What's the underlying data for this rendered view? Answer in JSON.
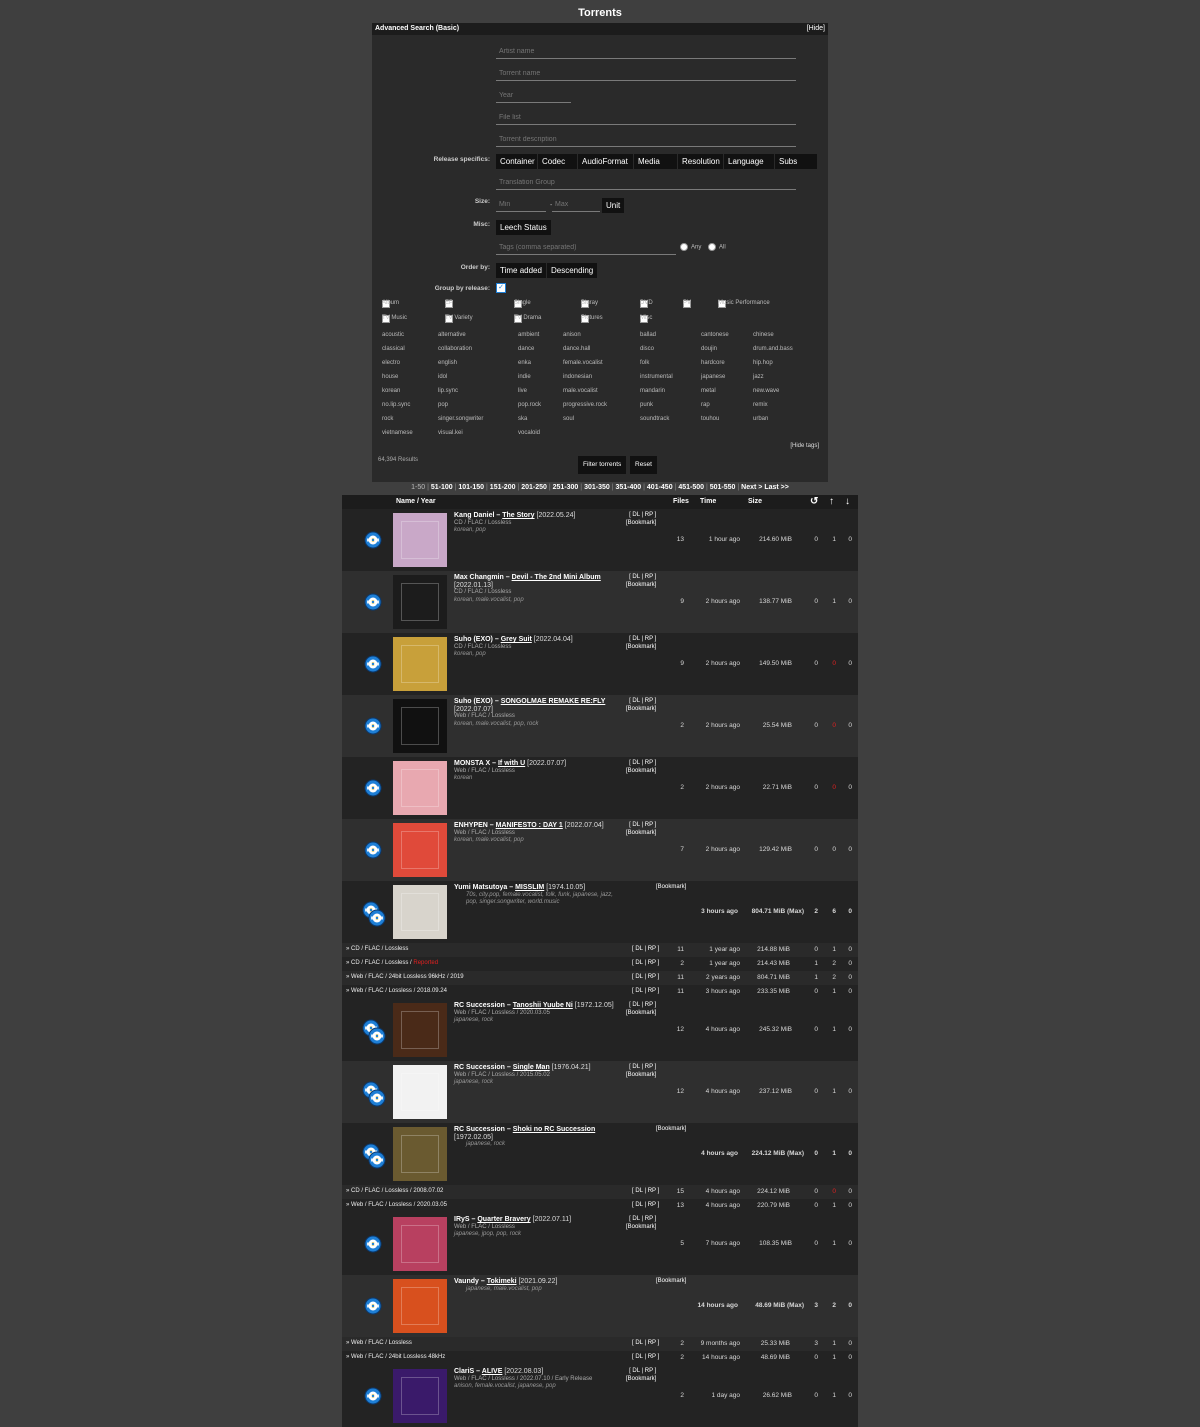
{
  "page_title": "Torrents",
  "search": {
    "title": "Advanced Search",
    "mode_link": "Basic",
    "hide_label": "[Hide]",
    "placeholders": {
      "artist": "Artist name",
      "torrent": "Torrent name",
      "year": "Year",
      "filelist": "File list",
      "description": "Torrent description",
      "translation": "Translation Group",
      "size_min": "Min",
      "size_max": "Max",
      "tags": "Tags (comma separated)"
    },
    "labels": {
      "release_specifics": "Release specifics:",
      "size": "Size:",
      "misc": "Misc:",
      "order_by": "Order by:",
      "group_by": "Group by release:"
    },
    "specifics": [
      "Container",
      "Codec",
      "AudioFormat",
      "Media",
      "Resolution",
      "Language",
      "Subs"
    ],
    "size_unit": "Unit",
    "size_sep": "-",
    "misc_select": "Leech Status",
    "tag_any": "Any",
    "tag_all": "All",
    "order_field": "Time added",
    "order_dir": "Descending",
    "categories_row1": [
      "Album",
      "EP",
      "Single",
      "Bluray",
      "DVD",
      "PV",
      "Music Performance"
    ],
    "categories_row2": [
      "TV Music",
      "TV Variety",
      "TV Drama",
      "Pictures",
      "Misc"
    ],
    "tags": [
      [
        "acoustic",
        "alternative",
        "ambient",
        "anison",
        "ballad",
        "cantonese",
        "chinese"
      ],
      [
        "classical",
        "collaboration",
        "dance",
        "dance.hall",
        "disco",
        "doujin",
        "drum.and.bass"
      ],
      [
        "electro",
        "english",
        "enka",
        "female.vocalist",
        "folk",
        "hardcore",
        "hip.hop"
      ],
      [
        "house",
        "idol",
        "indie",
        "indonesian",
        "instrumental",
        "japanese",
        "jazz"
      ],
      [
        "korean",
        "lip.sync",
        "live",
        "male.vocalist",
        "mandarin",
        "metal",
        "new.wave"
      ],
      [
        "no.lip.sync",
        "pop",
        "pop.rock",
        "progressive.rock",
        "punk",
        "rap",
        "remix"
      ],
      [
        "rock",
        "singer.songwriter",
        "ska",
        "soul",
        "soundtrack",
        "touhou",
        "urban"
      ],
      [
        "vietnamese",
        "visual.kei",
        "vocaloid",
        "",
        "",
        "",
        ""
      ]
    ],
    "hide_tags": "[Hide tags]",
    "results": "64,394 Results",
    "filter_btn": "Filter torrents",
    "reset_btn": "Reset"
  },
  "pager": {
    "current": "1-50",
    "pages": [
      "51-100",
      "101-150",
      "151-200",
      "201-250",
      "251-300",
      "301-350",
      "351-400",
      "401-450",
      "451-500",
      "501-550"
    ],
    "next": "Next >",
    "last": "Last >>"
  },
  "table_head": {
    "name": "Name / Year",
    "files": "Files",
    "time": "Time",
    "size": "Size"
  },
  "rows": [
    {
      "type": "group",
      "bg": "dark",
      "artist": "Kang Daniel",
      "title": "The Story",
      "date": "[2022.05.24]",
      "sub": "CD / FLAC / Lossless",
      "tags": "korean, pop",
      "dl": true,
      "files": "13",
      "time": "1 hour ago",
      "size": "214.60 MiB",
      "s": "0",
      "l": "1",
      "c": "0",
      "sred": false,
      "cover": "#c9a8c8",
      "icons": 1
    },
    {
      "type": "group",
      "bg": "light",
      "artist": "Max Changmin",
      "title": "Devil - The 2nd Mini Album",
      "date": "[2022.01.13]",
      "sub": "CD / FLAC / Lossless",
      "tags": "korean, male.vocalist, pop",
      "dl": true,
      "files": "9",
      "time": "2 hours ago",
      "size": "138.77 MiB",
      "s": "0",
      "l": "1",
      "c": "0",
      "sred": false,
      "cover": "#1c1c1c",
      "icons": 1
    },
    {
      "type": "group",
      "bg": "dark",
      "artist": "Suho (EXO)",
      "title": "Grey Suit",
      "date": "[2022.04.04]",
      "sub": "CD / FLAC / Lossless",
      "tags": "korean, pop",
      "dl": true,
      "files": "9",
      "time": "2 hours ago",
      "size": "149.50 MiB",
      "s": "0",
      "l": "0",
      "c": "0",
      "sred": true,
      "cover": "#c8a03a",
      "icons": 1
    },
    {
      "type": "group",
      "bg": "light",
      "artist": "Suho (EXO)",
      "title": "SONGOLMAE REMAKE RE:FLY",
      "date": "[2022.07.07]",
      "sub": "Web / FLAC / Lossless",
      "tags": "korean, male.vocalist, pop, rock",
      "dl": true,
      "files": "2",
      "time": "2 hours ago",
      "size": "25.54 MiB",
      "s": "0",
      "l": "0",
      "c": "0",
      "sred": true,
      "cover": "#111111",
      "icons": 1
    },
    {
      "type": "group",
      "bg": "dark",
      "artist": "MONSTA X",
      "title": "If with U",
      "date": "[2022.07.07]",
      "sub": "Web / FLAC / Lossless",
      "tags": "korean",
      "dl": true,
      "files": "2",
      "time": "2 hours ago",
      "size": "22.71 MiB",
      "s": "0",
      "l": "0",
      "c": "0",
      "sred": true,
      "cover": "#e8a8b0",
      "icons": 1
    },
    {
      "type": "group",
      "bg": "light",
      "artist": "ENHYPEN",
      "title": "MANIFESTO : DAY 1",
      "date": "[2022.07.04]",
      "sub": "Web / FLAC / Lossless",
      "tags": "korean, male.vocalist, pop",
      "dl": true,
      "files": "7",
      "time": "2 hours ago",
      "size": "129.42 MiB",
      "s": "0",
      "l": "0",
      "c": "0",
      "sred": false,
      "cover": "#e04a3a",
      "icons": 1
    },
    {
      "type": "multi",
      "bg": "dark",
      "artist": "Yumi Matsutoya",
      "title": "MISSLIM",
      "date": "[1974.10.05]",
      "tags": "70s, city.pop, female.vocalist, folk, funk, japanese, jazz, pop, singer.songwriter, world.music",
      "time": "3 hours ago",
      "size": "804.71 MiB (Max)",
      "s": "2",
      "l": "6",
      "c": "0",
      "cover": "#d8d4cc",
      "icons": 2
    },
    {
      "type": "edition",
      "ed": "CD / FLAC / Lossless",
      "files": "11",
      "time": "1 year ago",
      "size": "214.88 MiB",
      "s": "0",
      "l": "1",
      "c": "0",
      "alt": false
    },
    {
      "type": "edition",
      "ed": "CD / FLAC / Lossless / ",
      "reported": "Reported",
      "files": "2",
      "time": "1 year ago",
      "size": "214.43 MiB",
      "s": "1",
      "l": "2",
      "c": "0",
      "alt": true
    },
    {
      "type": "edition",
      "ed": "Web / FLAC / 24bit Lossless 96kHz / 2019",
      "files": "11",
      "time": "2 years ago",
      "size": "804.71 MiB",
      "s": "1",
      "l": "2",
      "c": "0",
      "alt": false
    },
    {
      "type": "edition",
      "ed": "Web / FLAC / Lossless / 2018.09.24",
      "files": "11",
      "time": "3 hours ago",
      "size": "233.35 MiB",
      "s": "0",
      "l": "1",
      "c": "0",
      "alt": true
    },
    {
      "type": "group",
      "bg": "dark",
      "artist": "RC Succession",
      "title": "Tanoshii Yuube Ni",
      "date": "[1972.12.05]",
      "sub": "Web / FLAC / Lossless / 2020.03.05",
      "tags": "japanese, rock",
      "dl": true,
      "files": "12",
      "time": "4 hours ago",
      "size": "245.32 MiB",
      "s": "0",
      "l": "1",
      "c": "0",
      "sred": false,
      "cover": "#4a2a18",
      "icons": 2
    },
    {
      "type": "group",
      "bg": "light",
      "artist": "RC Succession",
      "title": "Single Man",
      "date": "[1976.04.21]",
      "sub": "Web / FLAC / Lossless / 2015.05.02",
      "tags": "japanese, rock",
      "dl": true,
      "files": "12",
      "time": "4 hours ago",
      "size": "237.12 MiB",
      "s": "0",
      "l": "1",
      "c": "0",
      "sred": false,
      "cover": "#f2f2f2",
      "icons": 2
    },
    {
      "type": "multi",
      "bg": "dark",
      "artist": "RC Succession",
      "title": "Shoki no RC Succession",
      "date": "[1972.02.05]",
      "tags": "japanese, rock",
      "time": "4 hours ago",
      "size": "224.12 MiB (Max)",
      "s": "0",
      "l": "1",
      "c": "0",
      "cover": "#6a5a30",
      "icons": 2
    },
    {
      "type": "edition",
      "ed": "CD / FLAC / Lossless / 2008.07.02",
      "files": "15",
      "time": "4 hours ago",
      "size": "224.12 MiB",
      "s": "0",
      "l": "0",
      "c": "0",
      "alt": false,
      "lred": true
    },
    {
      "type": "edition",
      "ed": "Web / FLAC / Lossless / 2020.03.05",
      "files": "13",
      "time": "4 hours ago",
      "size": "220.79 MiB",
      "s": "0",
      "l": "1",
      "c": "0",
      "alt": true
    },
    {
      "type": "group",
      "bg": "dark",
      "artist": "IRyS",
      "title": "Quarter Bravery",
      "date": "[2022.07.11]",
      "sub": "Web / FLAC / Lossless",
      "tags": "japanese, jpop, pop, rock",
      "dl": true,
      "files": "5",
      "time": "7 hours ago",
      "size": "108.35 MiB",
      "s": "0",
      "l": "1",
      "c": "0",
      "sred": false,
      "cover": "#b84060",
      "icons": 1
    },
    {
      "type": "multi",
      "bg": "light",
      "artist": "Vaundy",
      "title": "Tokimeki",
      "date": "[2021.09.22]",
      "tags": "japanese, male.vocalist, pop",
      "time": "14 hours ago",
      "size": "48.69 MiB (Max)",
      "s": "3",
      "l": "2",
      "c": "0",
      "cover": "#d8501e",
      "icons": 1
    },
    {
      "type": "edition",
      "ed": "Web / FLAC / Lossless",
      "files": "2",
      "time": "9 months ago",
      "size": "25.33 MiB",
      "s": "3",
      "l": "1",
      "c": "0",
      "alt": false
    },
    {
      "type": "edition",
      "ed": "Web / FLAC / 24bit Lossless 48kHz",
      "files": "2",
      "time": "14 hours ago",
      "size": "48.69 MiB",
      "s": "0",
      "l": "1",
      "c": "0",
      "alt": true
    },
    {
      "type": "group",
      "bg": "dark",
      "artist": "ClariS",
      "title": "ALIVE",
      "date": "[2022.08.03]",
      "sub": "Web / FLAC / Lossless / 2022.07.10 / Early Release",
      "tags": "anison, female.vocalist, japanese, pop",
      "dl": true,
      "files": "2",
      "time": "1 day ago",
      "size": "26.62 MiB",
      "s": "0",
      "l": "1",
      "c": "0",
      "sred": false,
      "cover": "#3a1a6a",
      "icons": 1
    }
  ],
  "labels": {
    "dl": "DL",
    "rp": "RP",
    "bookmark": "[Bookmark]"
  },
  "colors": {
    "bg": "#3f3f3f",
    "panel": "#2a2a2a",
    "header": "#1c1c1c",
    "accent_red": "#e02020",
    "icon_blue": "#1e7fd6"
  }
}
